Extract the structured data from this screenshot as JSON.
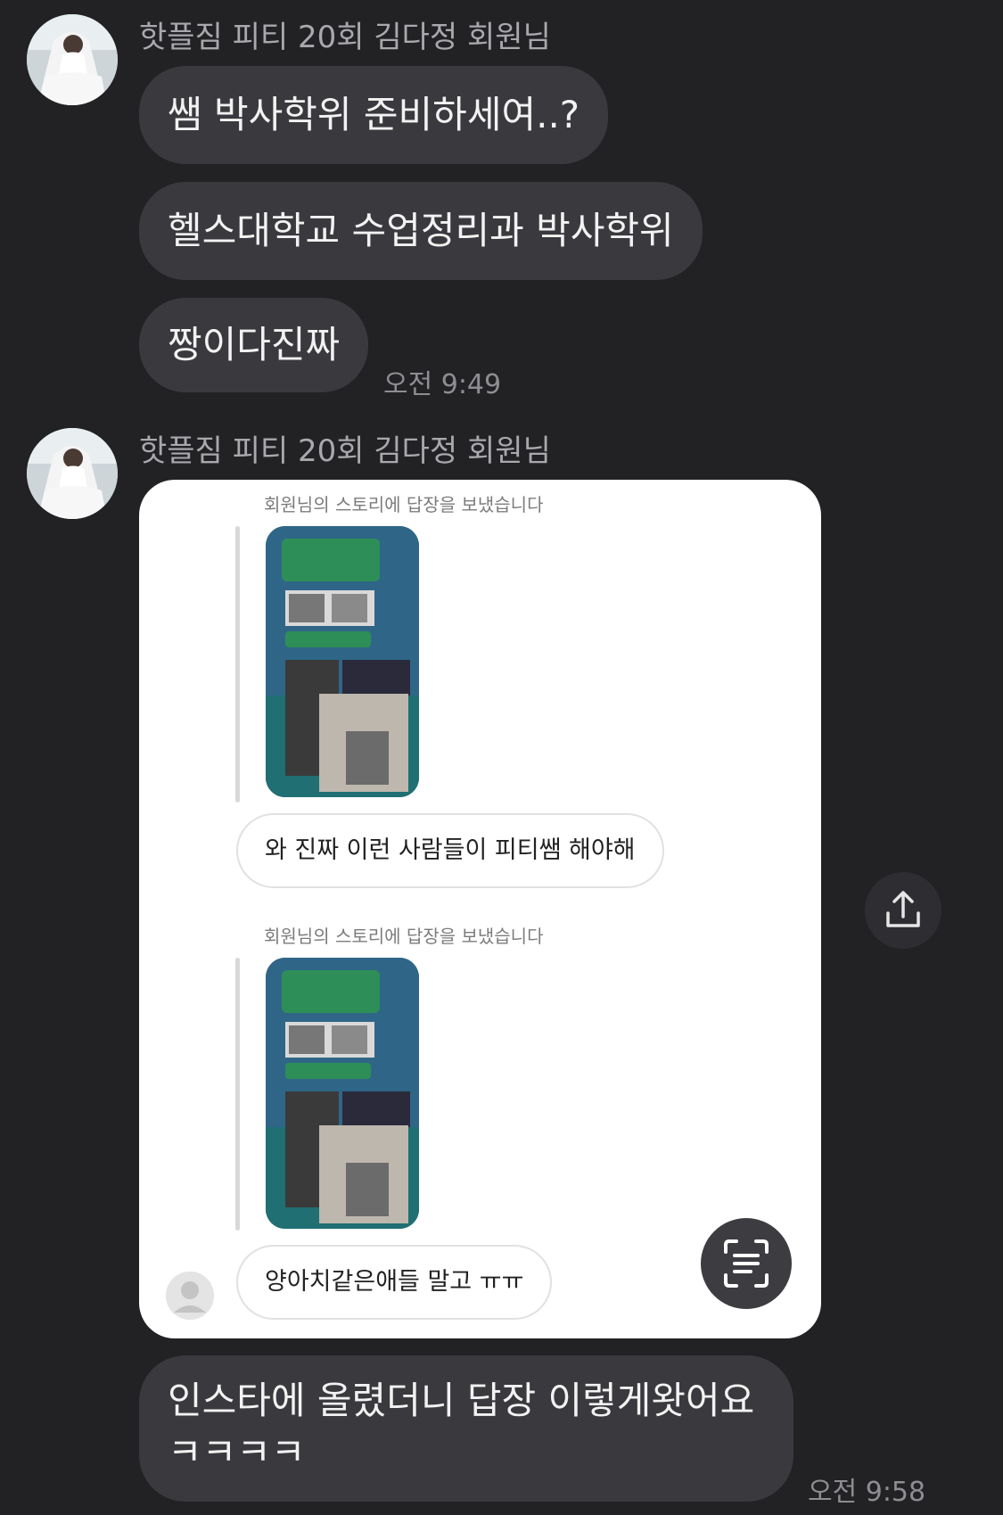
{
  "messages": [
    {
      "sender": "핫플짐 피티 20회 김다정 회원님",
      "bubbles": [
        "쌤 박사학위 준비하세여..?",
        "헬스대학교 수업정리과 박사학위",
        "짱이다진짜"
      ],
      "time": "오전 9:49"
    },
    {
      "sender": "핫플짐 피티 20회 김다정 회원님",
      "image": {
        "story_caption_1": "회원님의 스토리에 답장을 보냈습니다",
        "reply_1": "와 진짜 이런 사람들이 피티쌤 해야해",
        "story_caption_2": "회원님의 스토리에 답장을 보냈습니다",
        "reply_2": "양아치같은애들 말고 ㅠㅠ"
      },
      "text_line_1": "인스타에 올렸더니 답장 이렇게왓어요",
      "text_line_2": "ㅋㅋㅋㅋ",
      "time": "오전 9:58"
    }
  ],
  "icons": {
    "share": "share-icon",
    "scan_text": "scan-text-icon",
    "avatar": "avatar"
  },
  "colors": {
    "background": "#222225",
    "bubble": "#3a3a3e",
    "text": "#f2f2f2",
    "meta": "#a8a8ad"
  }
}
